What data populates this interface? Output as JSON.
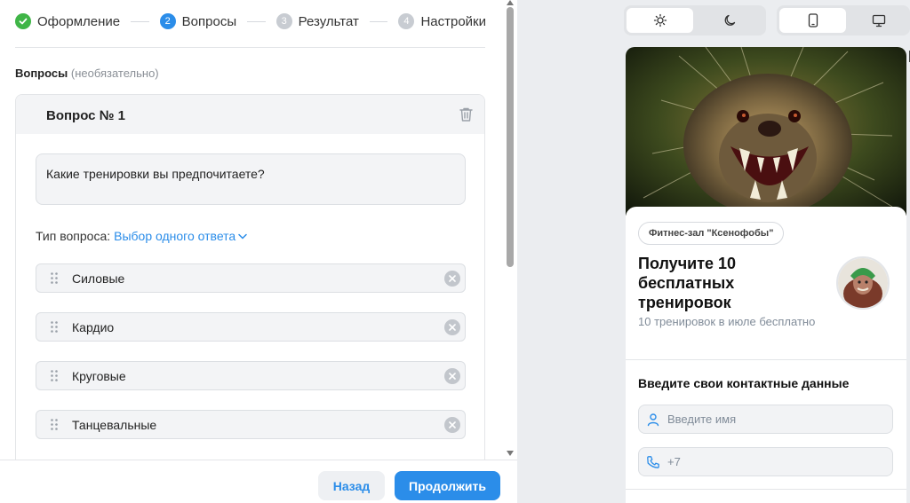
{
  "editor": {
    "steps": [
      {
        "num": "",
        "label": "Оформление",
        "state": "done"
      },
      {
        "num": "2",
        "label": "Вопросы",
        "state": "active"
      },
      {
        "num": "3",
        "label": "Результат",
        "state": "idle"
      },
      {
        "num": "4",
        "label": "Настройки",
        "state": "idle"
      }
    ],
    "section_title": "Вопросы",
    "section_optional": "(необязательно)",
    "question": {
      "title": "Вопрос № 1",
      "text": "Какие тренировки вы предпочитаете?",
      "type_label": "Тип вопроса:",
      "type_value": "Выбор одного ответа",
      "answers": [
        "Силовые",
        "Кардио",
        "Круговые",
        "Танцевальные"
      ]
    },
    "back_label": "Назад",
    "next_label": "Продолжить"
  },
  "preview": {
    "chip": "Фитнес-зал \"Ксенофобы\"",
    "title": "Получите 10 бесплатных тренировок",
    "subtitle": "10 тренировок в июле бесплатно",
    "form_title": "Введите свои контактные данные",
    "name_placeholder": "Введите имя",
    "phone_placeholder": "+7"
  },
  "colors": {
    "accent": "#2b8de9",
    "done": "#3fb547"
  },
  "icons": [
    "check-icon",
    "trash-icon",
    "chevron-down-icon",
    "drag-handle-icon",
    "remove-icon",
    "sun-icon",
    "moon-icon",
    "phone-icon",
    "desktop-icon",
    "user-icon",
    "phone-call-icon"
  ]
}
